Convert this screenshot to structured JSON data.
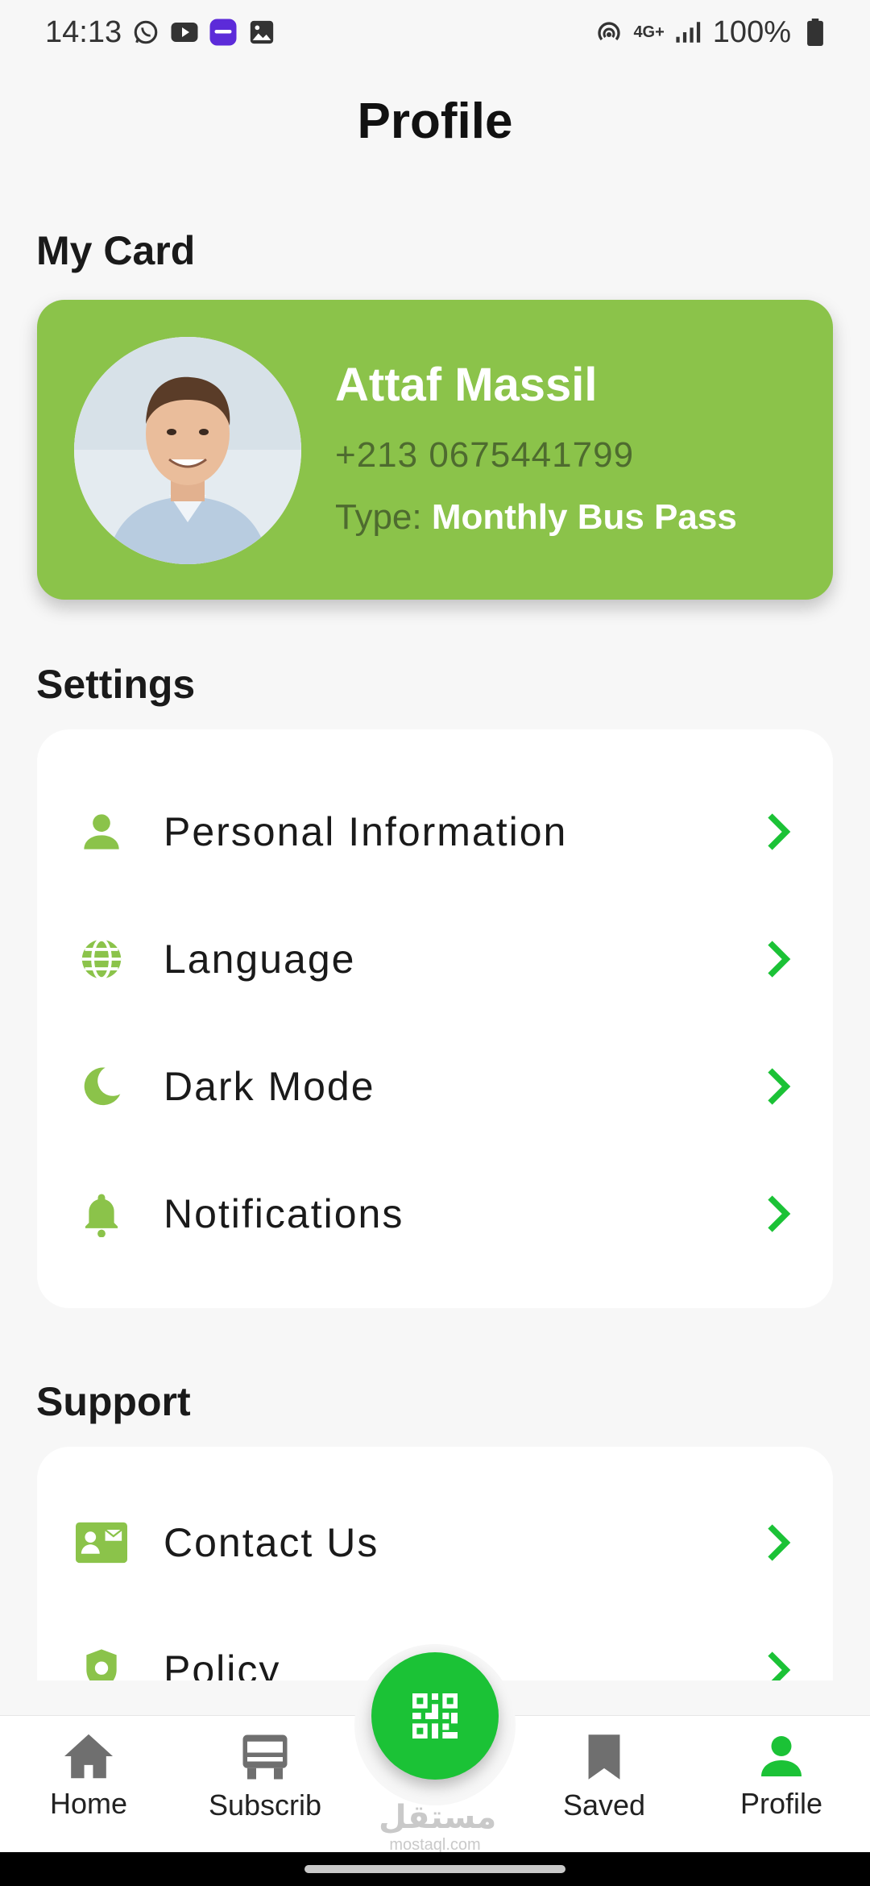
{
  "status_bar": {
    "time": "14:13",
    "battery": "100%",
    "network": "4G+"
  },
  "header": {
    "title": "Profile"
  },
  "my_card": {
    "section_title": "My Card",
    "name": "Attaf Massil",
    "phone": "+213 0675441799",
    "type_label": "Type: ",
    "type_value": "Monthly Bus Pass",
    "accent": "#8bc34a"
  },
  "settings": {
    "section_title": "Settings",
    "items": [
      {
        "label": "Personal Information",
        "icon": "person-icon"
      },
      {
        "label": "Language",
        "icon": "globe-icon"
      },
      {
        "label": "Dark Mode",
        "icon": "moon-icon"
      },
      {
        "label": "Notifications",
        "icon": "bell-icon"
      }
    ]
  },
  "support": {
    "section_title": "Support",
    "items": [
      {
        "label": "Contact Us",
        "icon": "contact-card-icon"
      },
      {
        "label": "Policy",
        "icon": "policy-icon"
      }
    ]
  },
  "bottom_nav": {
    "items": [
      {
        "label": "Home",
        "icon": "home-icon",
        "active": false
      },
      {
        "label": "Subscrib",
        "icon": "bus-icon",
        "active": false
      },
      {
        "label": "Saved",
        "icon": "bookmark-icon",
        "active": false
      },
      {
        "label": "Profile",
        "icon": "person-icon",
        "active": true
      }
    ],
    "fab_icon": "qr-code-icon",
    "active_color": "#1bc236"
  },
  "watermark": {
    "arabic": "مستقل",
    "latin": "mostaql.com"
  }
}
